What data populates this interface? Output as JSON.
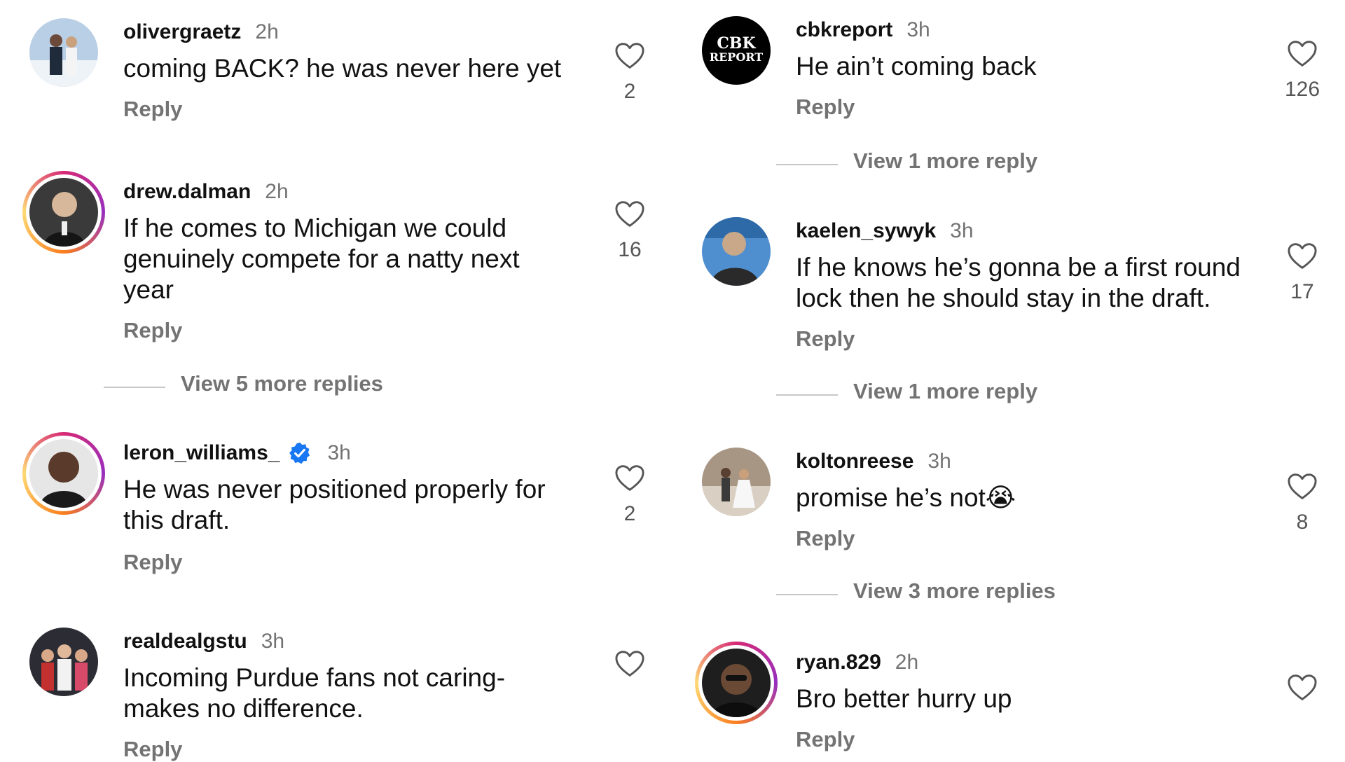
{
  "colors": {
    "text": "#111111",
    "muted": "#737373",
    "verified": "#1877f2",
    "story_ring": [
      "#d62976",
      "#962fbf",
      "#fa7e1e",
      "#feda75"
    ]
  },
  "labels": {
    "reply": "Reply"
  },
  "left_column": {
    "comments": [
      {
        "username": "olivergraetz",
        "time": "2h",
        "text": "coming BACK? he was never here yet",
        "likes": "2",
        "avatar_icon": "couple-photo",
        "story_ring": false
      },
      {
        "username": "drew.dalman",
        "time": "2h",
        "text": "If he comes to Michigan we could genuinely compete for a natty next year",
        "likes": "16",
        "avatar_icon": "person-photo",
        "story_ring": true
      },
      {
        "username": "leron_williams_",
        "time": "3h",
        "text": "He was never positioned properly for this draft.",
        "likes": "2",
        "avatar_icon": "person-photo",
        "story_ring": true,
        "verified": true
      },
      {
        "username": "realdealgstu",
        "time": "3h",
        "text": "Incoming Purdue fans not caring-makes no difference.",
        "likes": "",
        "avatar_icon": "group-photo",
        "story_ring": false
      }
    ],
    "replies_links": [
      {
        "label": "View 5 more replies"
      }
    ]
  },
  "right_column": {
    "comments": [
      {
        "username": "cbkreport",
        "time": "3h",
        "text": "He ain’t coming back",
        "likes": "126",
        "avatar_icon": "cbk-report-logo",
        "avatar_logo_lines": [
          "CBK",
          "REPORT"
        ],
        "story_ring": false
      },
      {
        "username": "kaelen_sywyk",
        "time": "3h",
        "text": "If he knows he’s gonna be a first round lock then he should stay in the draft.",
        "likes": "17",
        "avatar_icon": "person-photo",
        "story_ring": false
      },
      {
        "username": "koltonreese",
        "time": "3h",
        "text": "promise he’s not😭",
        "likes": "8",
        "avatar_icon": "couple-photo",
        "story_ring": false
      },
      {
        "username": "ryan.829",
        "time": "2h",
        "text": "Bro better hurry up",
        "likes": "",
        "avatar_icon": "person-photo",
        "story_ring": true
      }
    ],
    "replies_links": [
      {
        "label": "View 1 more reply"
      },
      {
        "label": "View 1 more reply"
      },
      {
        "label": "View 3 more replies"
      }
    ]
  }
}
